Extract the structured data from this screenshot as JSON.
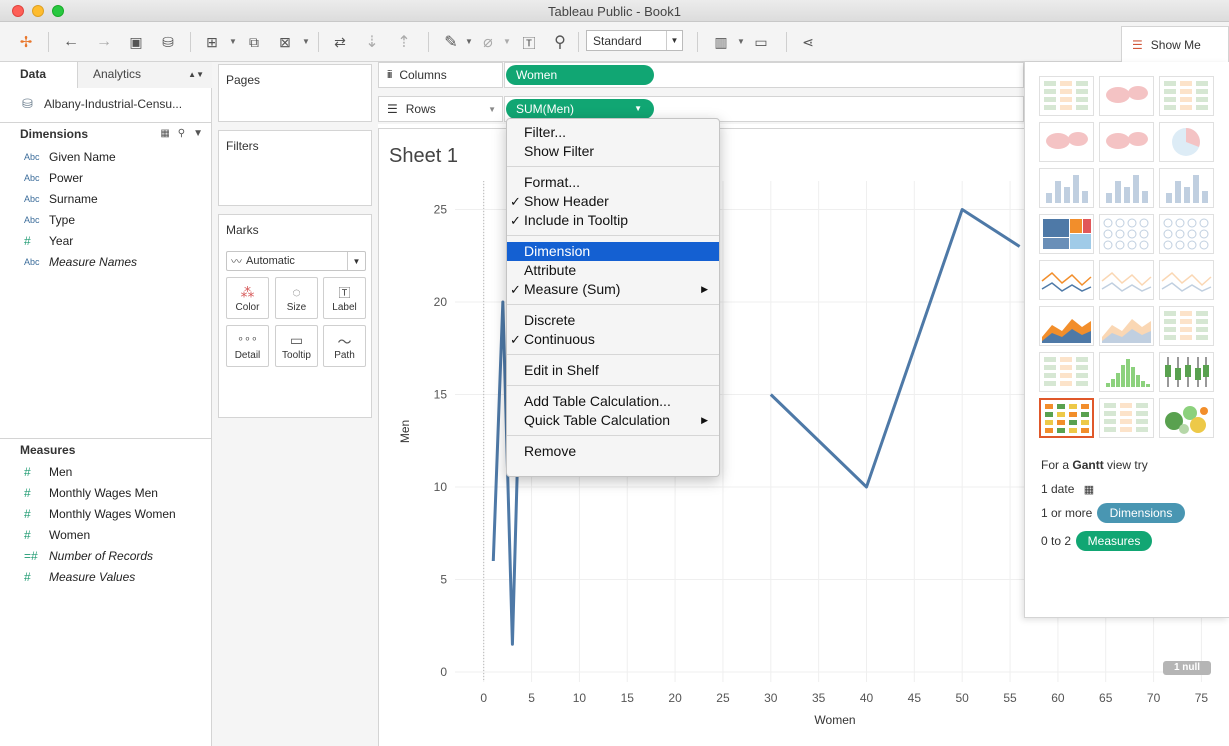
{
  "window": {
    "title": "Tableau Public - Book1"
  },
  "toolbar": {
    "icons": [
      "tableau-logo-icon",
      "back-icon",
      "forward-icon",
      "save-icon",
      "new-datasource-icon",
      "new-worksheet-icon",
      "duplicate-icon",
      "clear-icon",
      "swap-icon",
      "sort-ascending-icon",
      "sort-descending-icon",
      "highlight-icon",
      "group-icon",
      "text-icon",
      "pin-icon",
      "show-cards-icon",
      "presentation-icon",
      "share-icon"
    ],
    "fit_select": "Standard",
    "show_me_label": "Show Me"
  },
  "data_pane": {
    "tabs": {
      "data": "Data",
      "analytics": "Analytics"
    },
    "datasource": "Albany-Industrial-Censu...",
    "dimensions_header": "Dimensions",
    "dimensions": [
      {
        "type": "Abc",
        "name": "Given Name",
        "italic": false
      },
      {
        "type": "Abc",
        "name": "Power",
        "italic": false
      },
      {
        "type": "Abc",
        "name": "Surname",
        "italic": false
      },
      {
        "type": "Abc",
        "name": "Type",
        "italic": false
      },
      {
        "type": "#",
        "name": "Year",
        "italic": false
      },
      {
        "type": "Abc",
        "name": "Measure Names",
        "italic": true
      }
    ],
    "measures_header": "Measures",
    "measures": [
      {
        "type": "#",
        "name": "Men",
        "italic": false
      },
      {
        "type": "#",
        "name": "Monthly Wages Men",
        "italic": false
      },
      {
        "type": "#",
        "name": "Monthly Wages Women",
        "italic": false
      },
      {
        "type": "#",
        "name": "Women",
        "italic": false
      },
      {
        "type": "=#",
        "name": "Number of Records",
        "italic": true
      },
      {
        "type": "#",
        "name": "Measure Values",
        "italic": true
      }
    ]
  },
  "cards": {
    "pages": "Pages",
    "filters": "Filters",
    "marks": "Marks",
    "mark_type": "Automatic",
    "mark_buttons": [
      "Color",
      "Size",
      "Label",
      "Detail",
      "Tooltip",
      "Path"
    ]
  },
  "shelves": {
    "columns_label": "Columns",
    "rows_label": "Rows",
    "columns_pill": "Women",
    "rows_pill": "SUM(Men)"
  },
  "sheet": {
    "title": "Sheet 1",
    "null_badge": "1 null"
  },
  "context_menu": {
    "items": [
      {
        "label": "Filter...",
        "checked": false,
        "submenu": false,
        "highlight": false
      },
      {
        "label": "Show Filter",
        "checked": false,
        "submenu": false,
        "highlight": false
      },
      {
        "label": "Format...",
        "checked": false,
        "submenu": false,
        "highlight": false
      },
      {
        "label": "Show Header",
        "checked": true,
        "submenu": false,
        "highlight": false
      },
      {
        "label": "Include in Tooltip",
        "checked": true,
        "submenu": false,
        "highlight": false
      },
      {
        "label": "Dimension",
        "checked": false,
        "submenu": false,
        "highlight": true
      },
      {
        "label": "Attribute",
        "checked": false,
        "submenu": false,
        "highlight": false
      },
      {
        "label": "Measure (Sum)",
        "checked": true,
        "submenu": true,
        "highlight": false
      },
      {
        "label": "Discrete",
        "checked": false,
        "submenu": false,
        "highlight": false
      },
      {
        "label": "Continuous",
        "checked": true,
        "submenu": false,
        "highlight": false
      },
      {
        "label": "Edit in Shelf",
        "checked": false,
        "submenu": false,
        "highlight": false
      },
      {
        "label": "Add Table Calculation...",
        "checked": false,
        "submenu": false,
        "highlight": false
      },
      {
        "label": "Quick Table Calculation",
        "checked": false,
        "submenu": true,
        "highlight": false
      },
      {
        "label": "Remove",
        "checked": false,
        "submenu": false,
        "highlight": false
      }
    ]
  },
  "show_me": {
    "hint_prefix": "For a",
    "hint_chart": "Gantt",
    "hint_suffix": "view try",
    "req_date": "1 date",
    "req_dims_prefix": "1 or more",
    "req_dims_pill": "Dimensions",
    "req_meas_prefix": "0 to 2",
    "req_meas_pill": "Measures",
    "selected_chart": "gantt"
  },
  "colors": {
    "measure_pill": "#11a673",
    "dimension_pill": "#4996b2",
    "line": "#4e79a7",
    "highlight": "#1460d2",
    "selected_chart": "#e0582a"
  },
  "chart_data": {
    "type": "line",
    "xlabel": "Women",
    "ylabel": "Men",
    "xlim": [
      -3,
      76
    ],
    "ylim": [
      0,
      26
    ],
    "xticks": [
      0,
      5,
      10,
      15,
      20,
      25,
      30,
      35,
      40,
      45,
      50,
      55,
      60,
      65,
      70,
      75
    ],
    "yticks": [
      0,
      5,
      10,
      15,
      20,
      25
    ],
    "series": [
      {
        "name": "",
        "x": [
          1,
          2,
          3,
          4,
          30,
          40,
          50,
          56
        ],
        "y": [
          6,
          20,
          1.5,
          20,
          15,
          10,
          25,
          23
        ]
      }
    ]
  }
}
